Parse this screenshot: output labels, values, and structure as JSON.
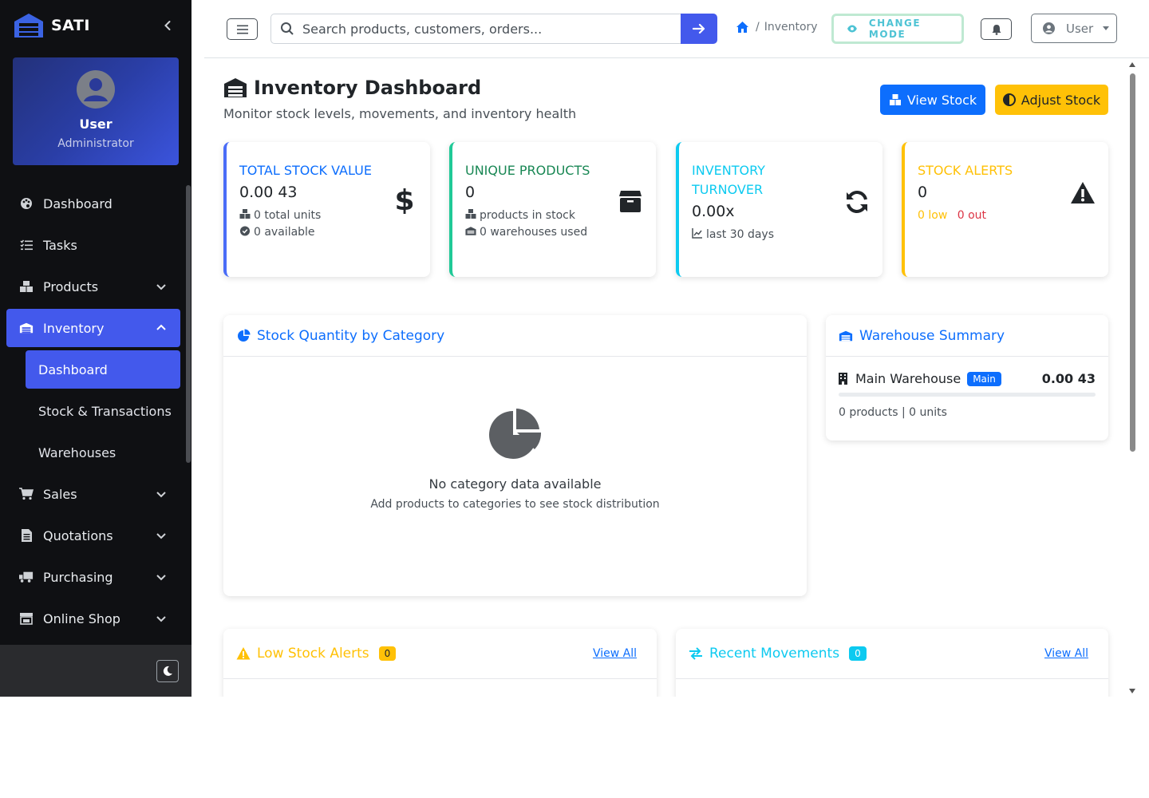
{
  "brand": {
    "name": "SATI"
  },
  "profile": {
    "name": "User",
    "role": "Administrator"
  },
  "sidebar": {
    "items": [
      {
        "label": "Dashboard",
        "icon": "palette-icon"
      },
      {
        "label": "Tasks",
        "icon": "list-check-icon"
      },
      {
        "label": "Products",
        "icon": "boxes-icon",
        "expandable": true
      },
      {
        "label": "Inventory",
        "icon": "warehouse-icon",
        "expanded": true,
        "active": true
      },
      {
        "label": "Sales",
        "icon": "cart-icon",
        "expandable": true
      },
      {
        "label": "Quotations",
        "icon": "file-invoice-icon",
        "expandable": true
      },
      {
        "label": "Purchasing",
        "icon": "truck-icon",
        "expandable": true
      },
      {
        "label": "Online Shop",
        "icon": "store-icon",
        "expandable": true
      }
    ],
    "inventory_sub": [
      {
        "label": "Dashboard",
        "active": true
      },
      {
        "label": "Stock & Transactions"
      },
      {
        "label": "Warehouses"
      }
    ]
  },
  "topbar": {
    "search_placeholder": "Search products, customers, orders...",
    "breadcrumb": "Inventory",
    "breadcrumb_sep": "/",
    "change_mode": "CHANGE MODE",
    "user_label": "User"
  },
  "page": {
    "title": "Inventory Dashboard",
    "subtitle": "Monitor stock levels, movements, and inventory health",
    "view_stock": "View Stock",
    "adjust_stock": "Adjust Stock"
  },
  "stats": {
    "total_value": {
      "label": "Total Stock Value",
      "value": "0.00 43",
      "units": "0 total units",
      "available": "0 available",
      "color": "#0d6efd"
    },
    "unique_products": {
      "label": "Unique Products",
      "value": "0",
      "in_stock": "products in stock",
      "warehouses": "0 warehouses used",
      "color": "#198754"
    },
    "turnover": {
      "label": "Inventory Turnover",
      "value": "0.00x",
      "period": "last 30 days",
      "color": "#0dcaf0"
    },
    "alerts": {
      "label": "Stock Alerts",
      "value": "0",
      "low": "0 low",
      "out": "0 out",
      "color": "#ffc107",
      "out_color": "#dc3545"
    }
  },
  "category_card": {
    "title": "Stock Quantity by Category",
    "empty_title": "No category data available",
    "empty_sub": "Add products to categories to see stock distribution"
  },
  "warehouse_card": {
    "title": "Warehouse Summary",
    "warehouse_name": "Main Warehouse",
    "badge": "Main",
    "amount": "0.00 43",
    "fill_fraction": 0,
    "meta": "0 products | 0 units"
  },
  "low_stock_card": {
    "title": "Low Stock Alerts",
    "count": "0",
    "link": "View All"
  },
  "movements_card": {
    "title": "Recent Movements",
    "count": "0",
    "link": "View All"
  },
  "colors": {
    "accent": "#4359ec",
    "primary": "#0d6efd",
    "warning": "#ffc107",
    "info": "#0dcaf0",
    "success": "#198754",
    "sidebar_bg": "#0f1013"
  }
}
